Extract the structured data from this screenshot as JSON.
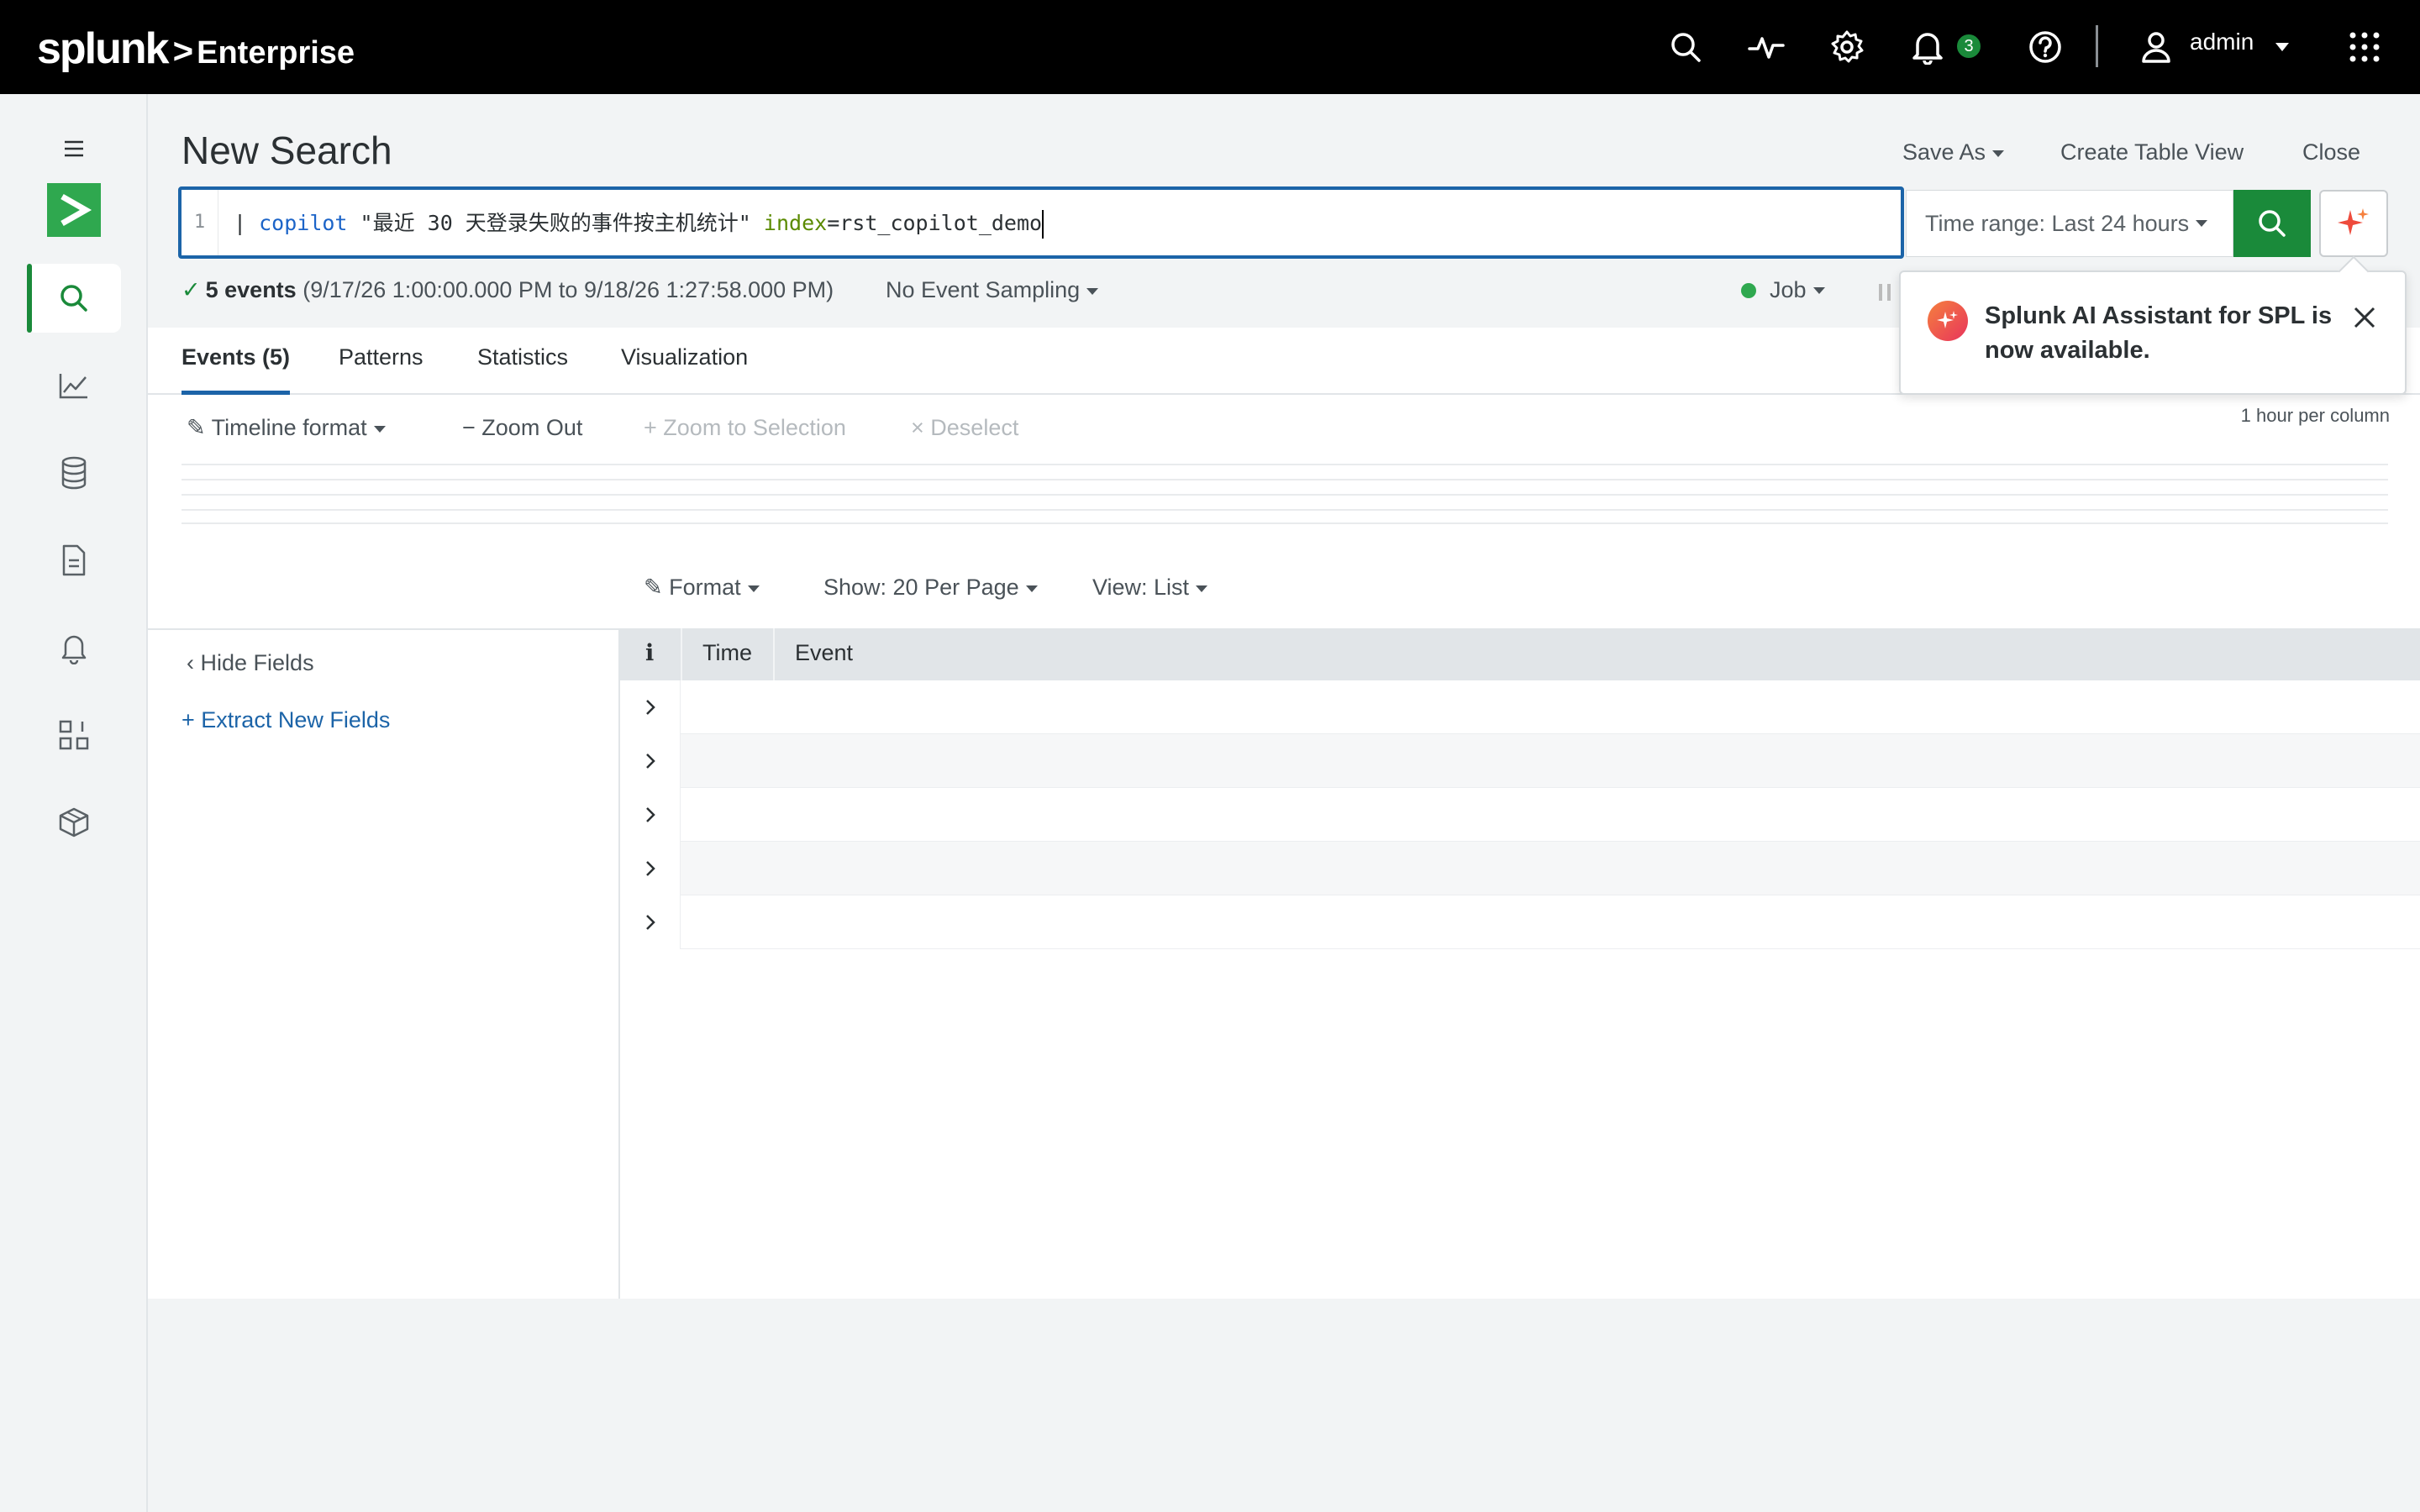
{
  "header": {
    "brand": "splunk",
    "chevron": ">",
    "product": "Enterprise",
    "notifications_count": "3",
    "user": "admin"
  },
  "page": {
    "title": "New Search",
    "actions": {
      "save_as": "Save As",
      "create_table_view": "Create Table View",
      "close": "Close"
    }
  },
  "search": {
    "line_number": "1",
    "query": {
      "pipe": "|",
      "command": "copilot",
      "string": "\"最近 30 天登录失败的事件按主机统计\"",
      "key": "index",
      "equals": "=",
      "value": "rst_copilot_demo"
    },
    "time_range": "Time range: Last 24 hours"
  },
  "status": {
    "events_count": "5 events",
    "range": "(9/17/26 1:00:00.000 PM to 9/18/26 1:27:58.000 PM)",
    "sampling": "No Event Sampling",
    "job": "Job"
  },
  "tabs": [
    {
      "label": "Events (5)",
      "active": true
    },
    {
      "label": "Patterns"
    },
    {
      "label": "Statistics"
    },
    {
      "label": "Visualization"
    }
  ],
  "timeline": {
    "format": "Timeline format",
    "zoom_out": "Zoom Out",
    "zoom_selection": "Zoom to Selection",
    "deselect": "Deselect",
    "per_column": "1 hour per column"
  },
  "results_bar": {
    "format": "Format",
    "show": "Show: 20 Per Page",
    "view": "View: List"
  },
  "fields": {
    "hide": "Hide Fields",
    "extract": "Extract New Fields"
  },
  "events_table": {
    "columns": [
      "i",
      "Time",
      "Event"
    ],
    "row_count": 5
  },
  "popover": {
    "text": "Splunk AI Assistant for SPL is now available."
  },
  "colors": {
    "accent_green": "#1a8a3a",
    "focus_blue": "#1c64a8"
  }
}
